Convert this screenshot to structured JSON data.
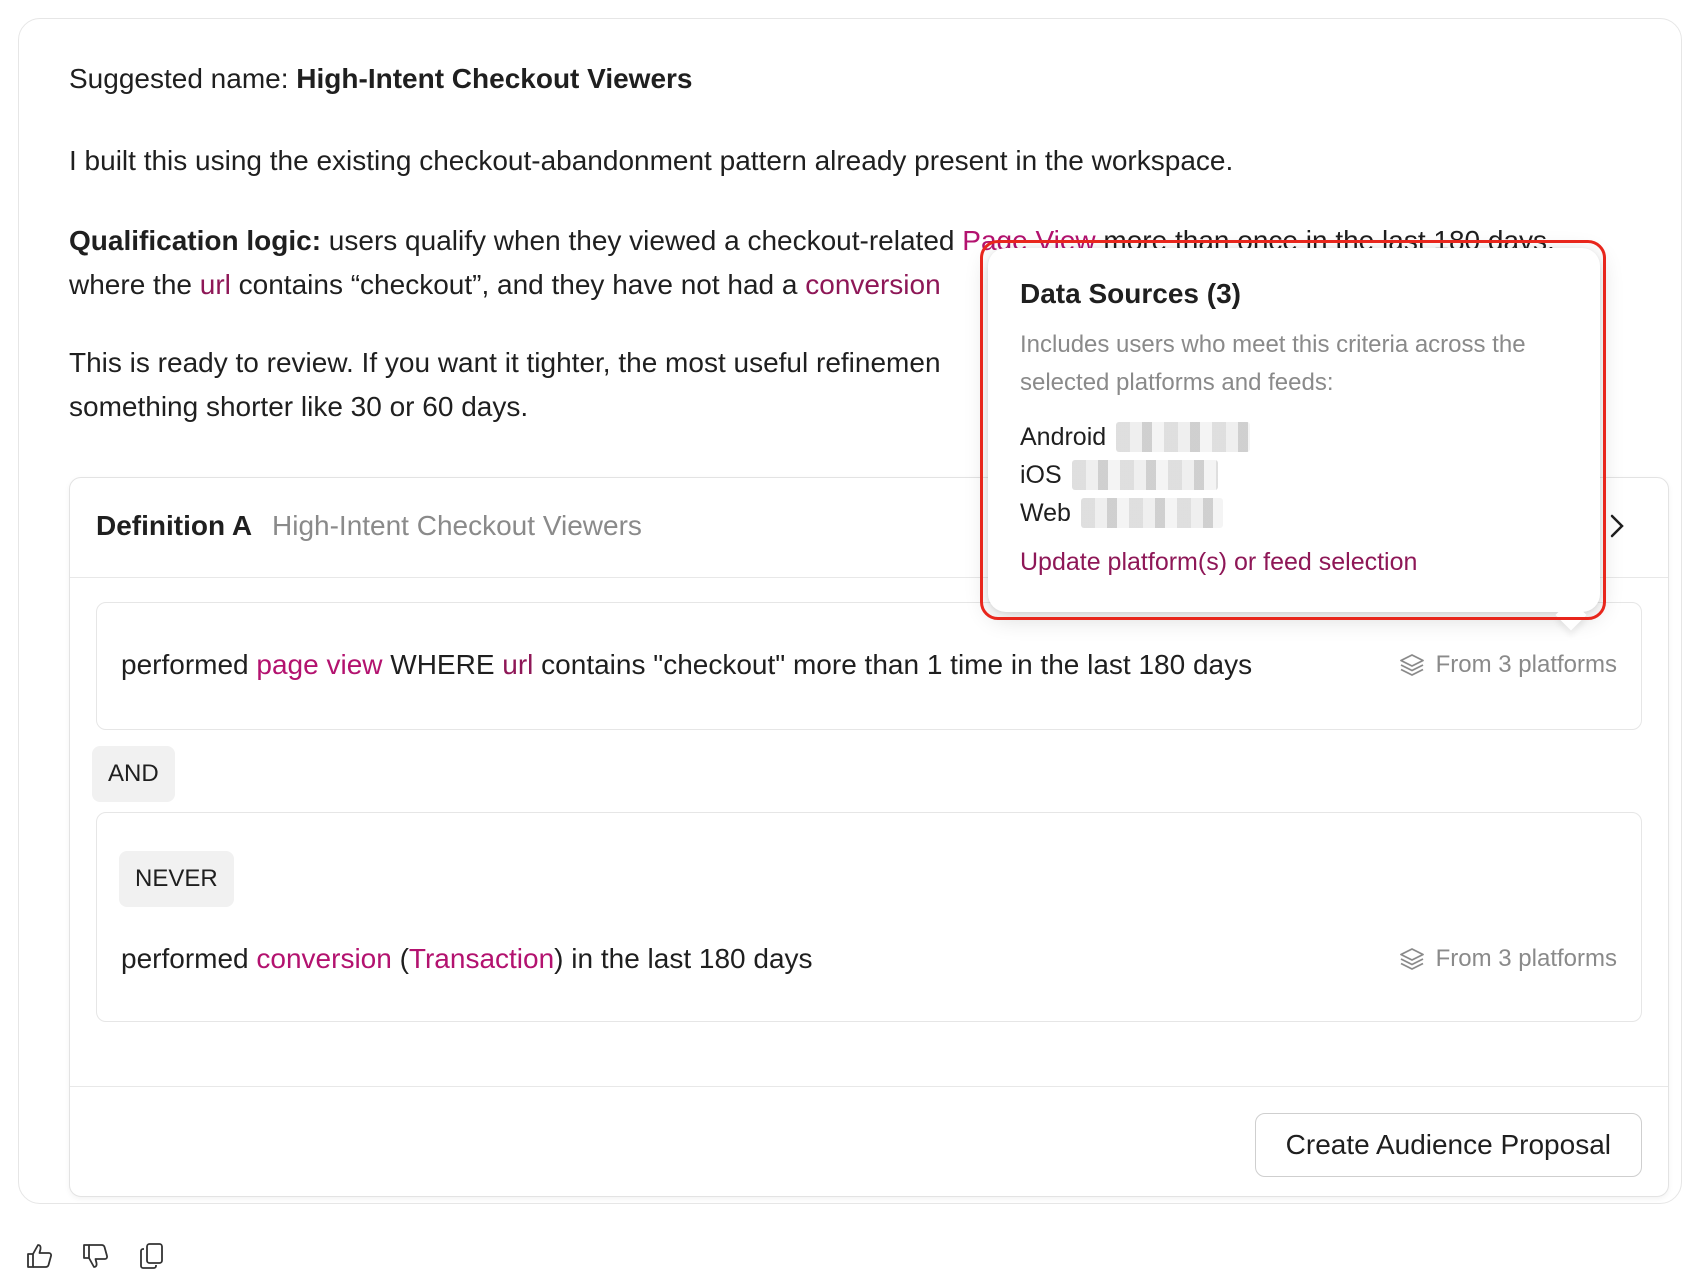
{
  "message": {
    "suggested_label": "Suggested name: ",
    "suggested_name": "High-Intent Checkout Viewers",
    "intro": "I built this using the existing checkout-abandonment pattern already present in the workspace.",
    "logic_label": "Qualification logic:",
    "logic_1": " users qualify when they viewed a checkout-related ",
    "logic_page_view": "Page View",
    "logic_2": " more than once in the last 180 days,",
    "logic_3": "where the ",
    "logic_url": "url",
    "logic_4": " contains “checkout”, and they have not had a ",
    "logic_conversion": "conversion",
    "review_1": "This is ready to review. If you want it tighter, the most useful refinemen",
    "review_2": "something shorter like 30 or 60 days."
  },
  "definition": {
    "title": "Definition A",
    "subtitle": "High-Intent Checkout Viewers",
    "condition_1": {
      "performed": "performed ",
      "event": "page view",
      "where": " WHERE ",
      "field": "url",
      "rest": " contains \"checkout\" more than 1 time in the last 180 days",
      "source": "From 3 platforms"
    },
    "and_label": "AND",
    "never_label": "NEVER",
    "condition_2": {
      "performed": "performed ",
      "event": "conversion",
      "open": " (",
      "detail": "Transaction",
      "rest": ") in the last 180 days",
      "source": "From 3 platforms"
    },
    "create_button": "Create Audience Proposal"
  },
  "popover": {
    "title": "Data Sources (3)",
    "description": "Includes users who meet this criteria across the selected platforms and feeds:",
    "platforms": [
      "Android",
      "iOS",
      "Web"
    ],
    "link": "Update platform(s) or feed selection"
  },
  "colors": {
    "accent": "#b3126f",
    "link": "#8e1757",
    "highlight": "#e8261c"
  },
  "icons": [
    "layers-icon",
    "thumbs-up-icon",
    "thumbs-down-icon",
    "copy-icon",
    "chevron-right-icon"
  ]
}
